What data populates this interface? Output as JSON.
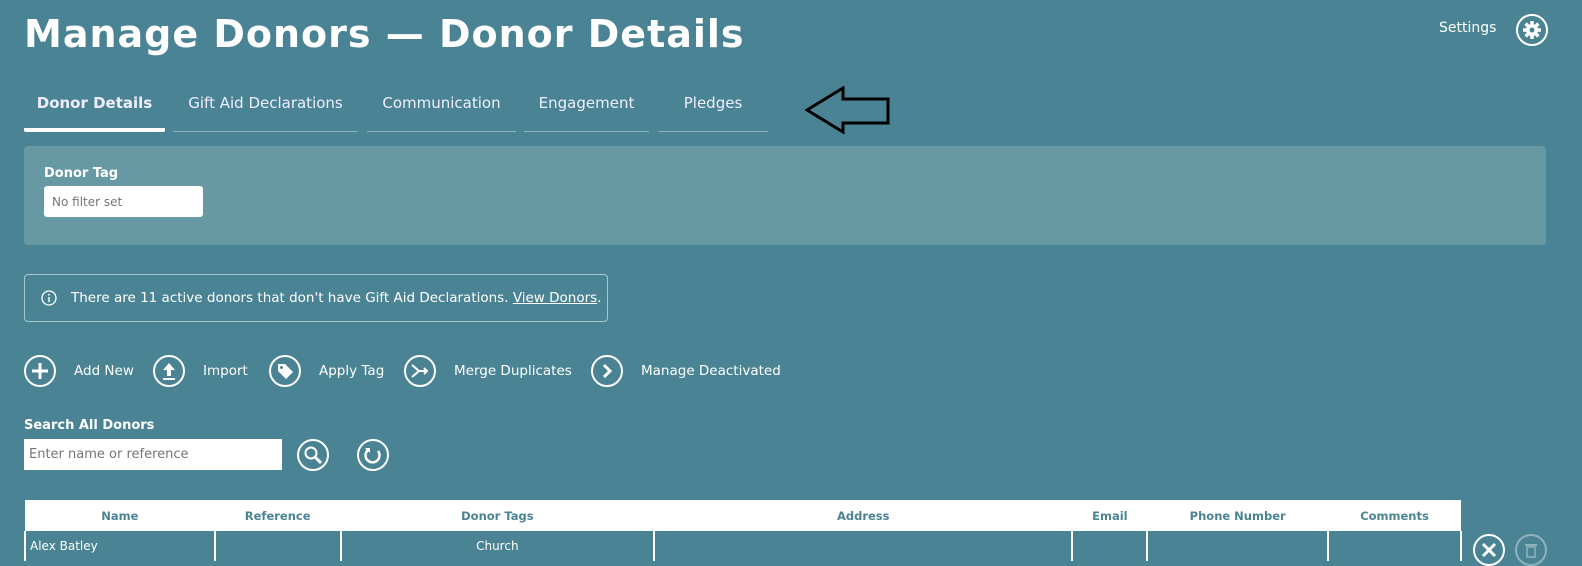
{
  "header": {
    "title": "Manage Donors — Donor Details",
    "settings_label": "Settings"
  },
  "tabs": [
    {
      "label": "Donor Details"
    },
    {
      "label": "Gift Aid Declarations"
    },
    {
      "label": "Communication"
    },
    {
      "label": "Engagement"
    },
    {
      "label": "Pledges"
    }
  ],
  "filter": {
    "label": "Donor Tag",
    "placeholder": "No filter set"
  },
  "notice": {
    "text": "There are 11 active donors that don't have Gift Aid Declarations.",
    "link": "View Donors",
    "suffix": "."
  },
  "actions": [
    {
      "label": "Add New"
    },
    {
      "label": "Import"
    },
    {
      "label": "Apply Tag"
    },
    {
      "label": "Merge Duplicates"
    },
    {
      "label": "Manage Deactivated"
    }
  ],
  "search": {
    "label": "Search All Donors",
    "placeholder": "Enter name or reference"
  },
  "table": {
    "columns": [
      "Name",
      "Reference",
      "Donor Tags",
      "Address",
      "Email",
      "Phone Number",
      "Comments"
    ],
    "rows": [
      {
        "name": "Alex Batley",
        "reference": "",
        "tags": "Church",
        "address": "",
        "email": "",
        "phone": "",
        "comments": ""
      }
    ]
  }
}
